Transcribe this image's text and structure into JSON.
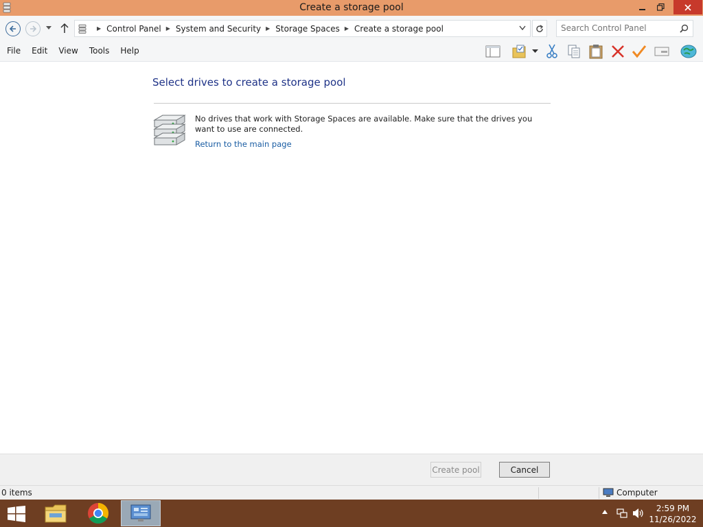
{
  "window": {
    "title": "Create a storage pool",
    "minimize_label": "minimize",
    "maximize_label": "restore",
    "close_label": "close"
  },
  "address": {
    "breadcrumbs": [
      "Control Panel",
      "System and Security",
      "Storage Spaces",
      "Create a storage pool"
    ]
  },
  "search": {
    "placeholder": "Search Control Panel"
  },
  "menu": {
    "items": [
      "File",
      "Edit",
      "View",
      "Tools",
      "Help"
    ]
  },
  "toolbar": {
    "icons": [
      "layout-icon",
      "folder-check-icon",
      "dropdown-arrow-icon",
      "cut-icon",
      "copy-icon",
      "paste-icon",
      "delete-icon",
      "checkmark-icon",
      "properties-icon",
      "globe-icon"
    ]
  },
  "content": {
    "heading": "Select drives to create a storage pool",
    "message": "No drives that work with Storage Spaces are available. Make sure that the drives you want to use are connected.",
    "link": "Return to the main page"
  },
  "footer": {
    "create_label": "Create pool",
    "cancel_label": "Cancel"
  },
  "status": {
    "items": "0 items",
    "location": "Computer"
  },
  "taskbar": {
    "time": "2:59 PM",
    "date": "11/26/2022"
  },
  "colors": {
    "titlebar": "#e89b6a",
    "close_button": "#c7392b",
    "heading": "#1e3287",
    "link": "#1a5da3",
    "taskbar": "#6e3e22"
  }
}
